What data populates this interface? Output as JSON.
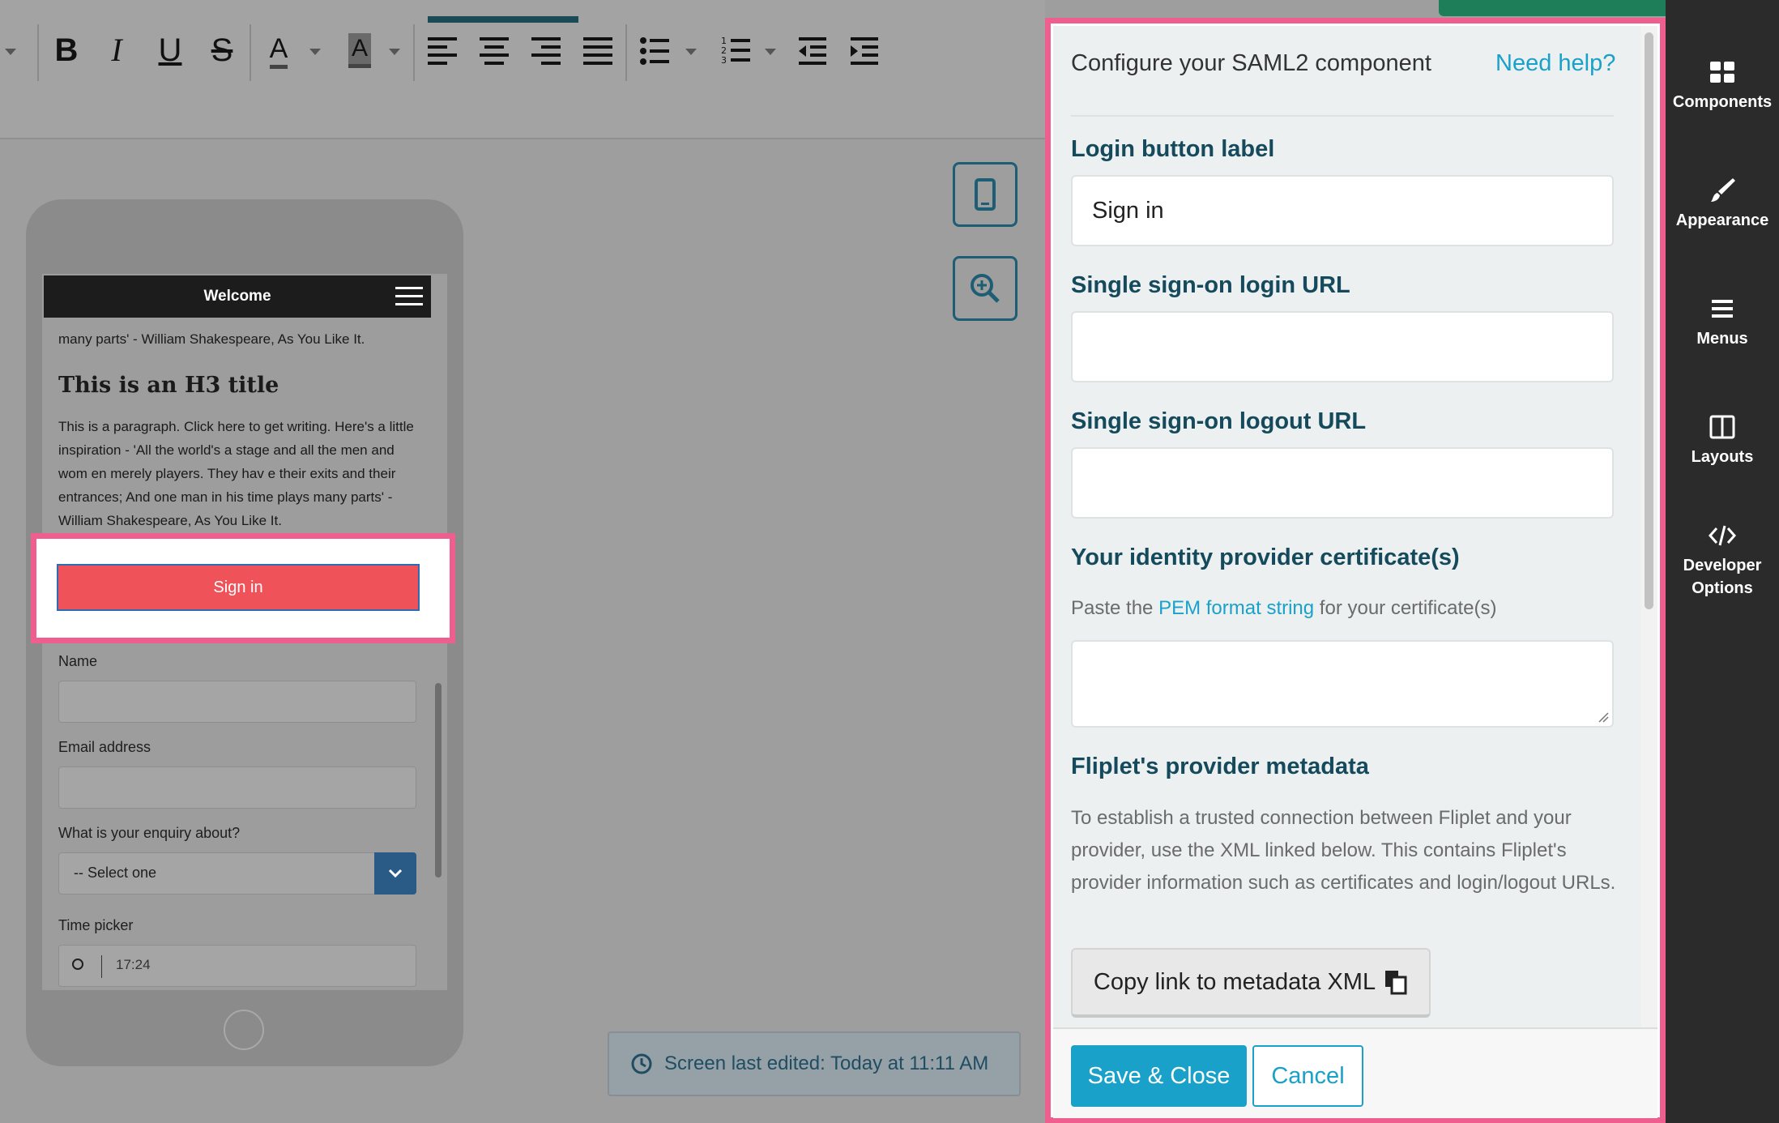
{
  "toolbar": {
    "buttons": [
      "bold",
      "italic",
      "underline",
      "strikethrough",
      "text-color",
      "highlight-color",
      "align-left",
      "align-center",
      "align-right",
      "align-justify",
      "bullet-list",
      "numbered-list",
      "outdent",
      "indent"
    ],
    "active_tab_color": "#1a4a55"
  },
  "preview": {
    "header_title": "Welcome",
    "intro_text": "many parts' - William Shakespeare, As You Like It.",
    "h3_title": "This is an H3 title",
    "paragraph": "This is a paragraph. Click here to get writing. Here's a little inspiration - 'All the world's a stage and all the men and wom en merely players. They hav e their exits and their entrances; And one man in his time plays many parts' - William Shakespeare, As You Like It.",
    "signin_label": "Sign in",
    "fields": {
      "name_label": "Name",
      "email_label": "Email address",
      "enquiry_label": "What is your enquiry about?",
      "select_value": "-- Select one",
      "time_label": "Time picker",
      "time_value": "17:24"
    }
  },
  "tools": {
    "device_icon": "phone-icon",
    "zoom_icon": "zoom-in-icon"
  },
  "status": {
    "text": "Screen last edited: Today at 11:11 AM"
  },
  "panel": {
    "title": "Configure your SAML2 component",
    "help_link": "Need help?",
    "login_label_title": "Login button label",
    "login_label_value": "Sign in",
    "sso_login_title": "Single sign-on login URL",
    "sso_login_value": "",
    "sso_logout_title": "Single sign-on logout URL",
    "sso_logout_value": "",
    "cert_title": "Your identity provider certificate(s)",
    "cert_help_pre": "Paste the",
    "cert_help_link": "PEM format string",
    "cert_help_post": "for your certificate(s)",
    "metadata_title": "Fliplet's provider metadata",
    "metadata_text": "To establish a trusted connection between Fliplet and your provider, use the XML linked below. This contains Fliplet's provider information such as certificates and login/logout URLs.",
    "copy_button": "Copy link to metadata XML",
    "save_button": "Save & Close",
    "cancel_button": "Cancel"
  },
  "rail": {
    "items": [
      {
        "label": "Components",
        "icon": "grid-icon"
      },
      {
        "label": "Appearance",
        "icon": "brush-icon"
      },
      {
        "label": "Menus",
        "icon": "hamburger-icon"
      },
      {
        "label": "Layouts",
        "icon": "layout-icon"
      },
      {
        "label": "Developer Options",
        "icon": "code-icon"
      }
    ]
  },
  "colors": {
    "accent": "#1aa1c9",
    "heading": "#154a5c",
    "highlight": "#ee5f8f",
    "primary_green": "#1e7e5a",
    "signin_red": "#f0525a"
  }
}
